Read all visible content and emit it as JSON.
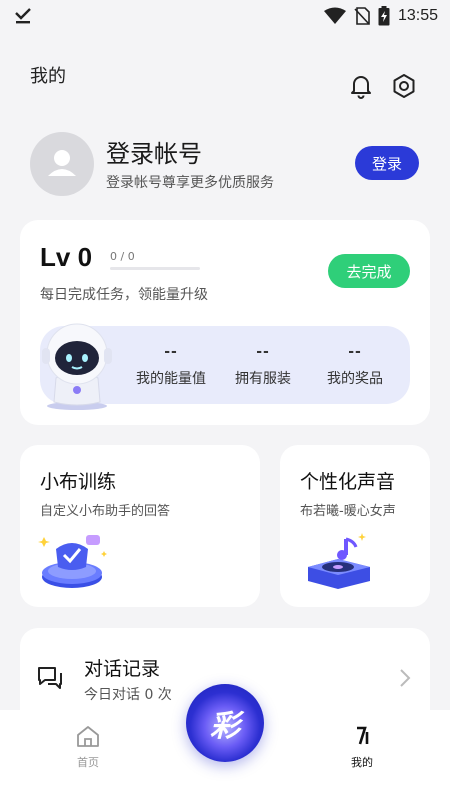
{
  "status_bar": {
    "time": "13:55"
  },
  "header": {
    "title": "我的"
  },
  "profile": {
    "login_title": "登录帐号",
    "login_subtitle": "登录帐号尊享更多优质服务",
    "login_button": "登录"
  },
  "level": {
    "level_label": "Lv 0",
    "progress_text": "0 / 0",
    "progress_fraction": 0,
    "description": "每日完成任务，领能量升级",
    "complete_button": "去完成",
    "stats": [
      {
        "value": "--",
        "label": "我的能量值"
      },
      {
        "value": "--",
        "label": "拥有服装"
      },
      {
        "value": "--",
        "label": "我的奖品"
      }
    ]
  },
  "features": {
    "training": {
      "title": "小布训练",
      "subtitle": "自定义小布助手的回答"
    },
    "voice": {
      "title": "个性化声音",
      "subtitle": "布若曦-暖心女声"
    }
  },
  "history": {
    "title": "对话记录",
    "subtitle": "今日对话 0 次"
  },
  "bottom_nav": {
    "home_label": "首页",
    "mine_label": "我的",
    "center_glyph": "彩"
  },
  "colors": {
    "accent": "#2b3ad8",
    "success": "#2fcf79",
    "stats_bg": "#e8ebfb"
  }
}
